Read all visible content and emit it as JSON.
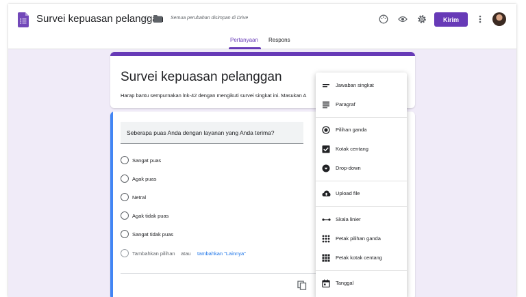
{
  "header": {
    "doc_title": "Survei kepuasan pelanggan",
    "saved_status": "Semua perubahan disimpan di Drive",
    "send_label": "Kirim",
    "icons": [
      "forms-logo-icon",
      "star-icon",
      "folder-icon",
      "palette-icon",
      "eye-icon",
      "gear-icon",
      "more-vert-icon",
      "avatar"
    ]
  },
  "tabs": [
    {
      "label": "Pertanyaan",
      "active": true
    },
    {
      "label": "Respons",
      "active": false
    }
  ],
  "form": {
    "title": "Survei kepuasan pelanggan",
    "description": "Harap bantu sempurnakan lnk-42 dengan mengikuti survei singkat ini. Masukan A"
  },
  "question": {
    "text": "Seberapa puas Anda dengan layanan yang Anda terima?",
    "options": [
      "Sangat puas",
      "Agak puas",
      "Netral",
      "Agak tidak puas",
      "Sangat tidak puas"
    ],
    "add_option": "Tambahkan pilihan",
    "add_or": "atau",
    "add_other": "tambahkan \"Lainnya\""
  },
  "type_menu": {
    "items": [
      {
        "label": "Jawaban singkat",
        "icon": "short-answer-icon"
      },
      {
        "label": "Paragraf",
        "icon": "paragraph-icon"
      },
      {
        "label": "Pilihan ganda",
        "icon": "radio-icon"
      },
      {
        "label": "Kotak centang",
        "icon": "checkbox-icon"
      },
      {
        "label": "Drop-down",
        "icon": "dropdown-icon"
      },
      {
        "label": "Upload file",
        "icon": "upload-icon"
      },
      {
        "label": "Skala linier",
        "icon": "linear-scale-icon"
      },
      {
        "label": "Petak pilihan ganda",
        "icon": "grid-icon"
      },
      {
        "label": "Petak kotak centang",
        "icon": "checkbox-grid-icon"
      },
      {
        "label": "Tanggal",
        "icon": "calendar-icon"
      }
    ]
  },
  "colors": {
    "accent": "#673ab7",
    "background": "#f0ebf8",
    "question_accent": "#4285f4",
    "link": "#1a73e8"
  }
}
